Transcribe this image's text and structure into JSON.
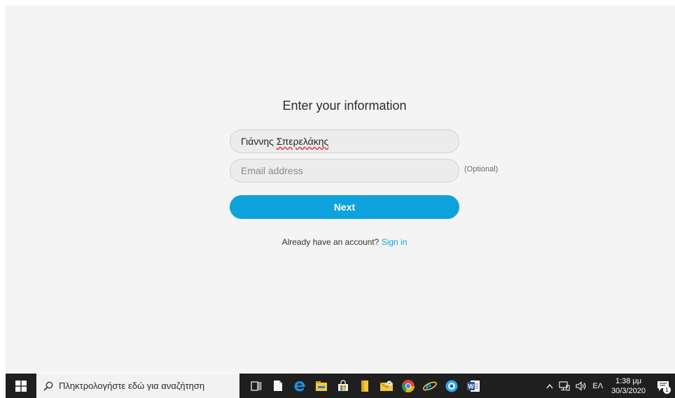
{
  "form": {
    "title": "Enter your information",
    "name_first": "Γιάννης",
    "name_last": "Σπερελάκης",
    "email_placeholder": "Email address",
    "email_value": "",
    "optional_label": "(Optional)",
    "next_label": "Next",
    "signin_prompt": "Already have an account?",
    "signin_link": "Sign in"
  },
  "colors": {
    "accent": "#0ea3dc",
    "background": "#f4f4f4",
    "taskbar": "#1f1f1f"
  },
  "taskbar": {
    "search_placeholder": "Πληκτρολογήστε εδώ για αναζήτηση",
    "apps": [
      {
        "name": "task-view-icon"
      },
      {
        "name": "file-icon"
      },
      {
        "name": "edge-icon"
      },
      {
        "name": "file-explorer-icon"
      },
      {
        "name": "store-icon"
      },
      {
        "name": "folder-icon"
      },
      {
        "name": "mail-icon"
      },
      {
        "name": "chrome-icon"
      },
      {
        "name": "internet-explorer-icon"
      },
      {
        "name": "app-icon"
      },
      {
        "name": "word-icon"
      }
    ],
    "tray": {
      "language": "ΕΛ",
      "time": "1:38 μμ",
      "date": "30/3/2020",
      "notification_count": "1"
    }
  }
}
